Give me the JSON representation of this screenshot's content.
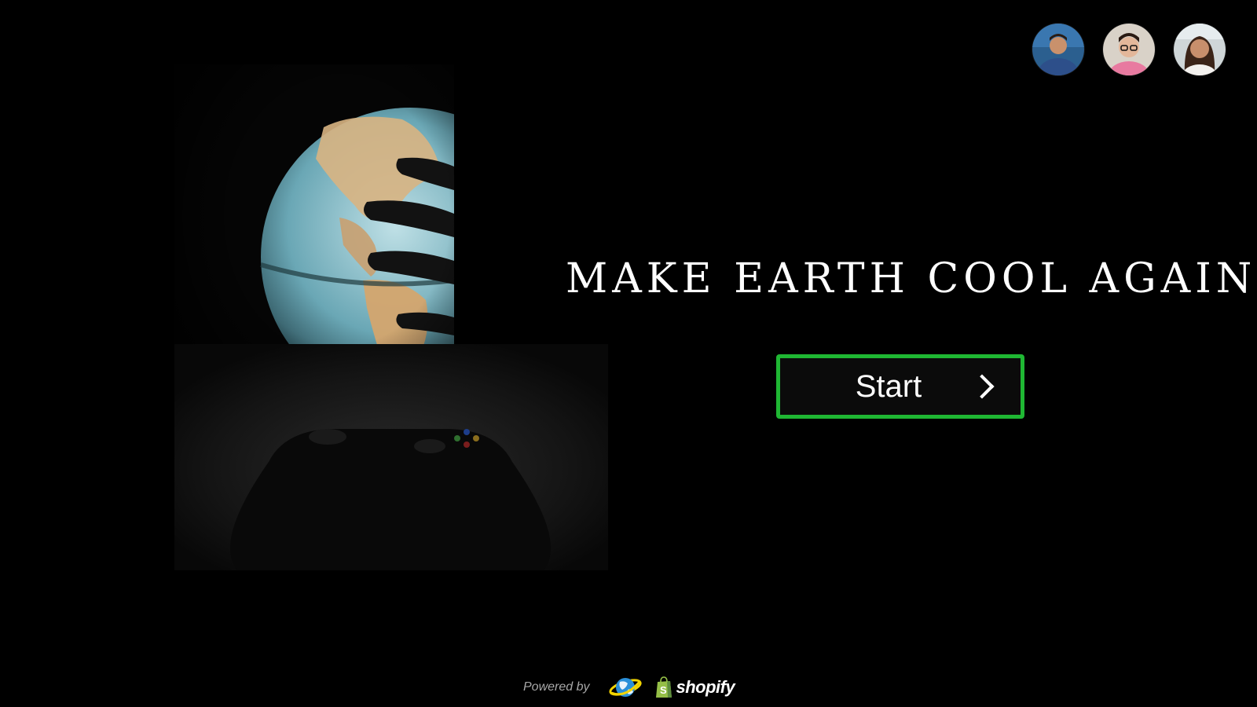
{
  "title": "Make Earth Cool Again",
  "start_button": {
    "label": "Start"
  },
  "footer": {
    "powered_by": "Powered by",
    "brand": "shopify"
  },
  "avatars": [
    {
      "name": "avatar-1"
    },
    {
      "name": "avatar-2"
    },
    {
      "name": "avatar-3"
    }
  ],
  "colors": {
    "background": "#000000",
    "button_border": "#1fb733",
    "shopify_green": "#95bf47"
  },
  "icons": [
    "chevron-right-icon",
    "earth-logo-icon",
    "shopify-bag-icon"
  ]
}
